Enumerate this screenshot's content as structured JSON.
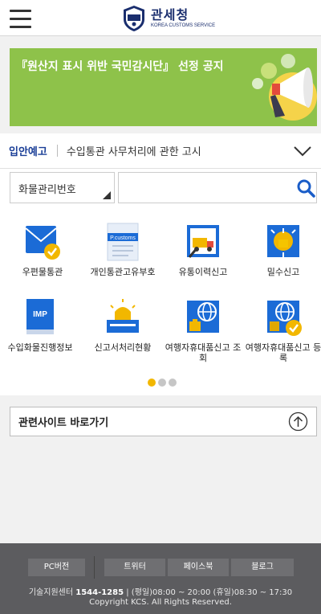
{
  "header": {
    "logo_ko": "관세청",
    "logo_en": "KOREA CUSTOMS SERVICE"
  },
  "banner": {
    "text": "『원산지 표시 위반 국민감시단』 선정 공지",
    "slide_count": 5,
    "active_slide": 1
  },
  "notice": {
    "label": "입안예고",
    "text": "수입통관 사무처리에 관한 고시"
  },
  "search": {
    "select_value": "화물관리번호",
    "input_value": "",
    "placeholder": ""
  },
  "menu": {
    "items": [
      {
        "label": "우편물통관",
        "icon": "mail-check-icon"
      },
      {
        "label": "개인통관고유부호",
        "icon": "pcustoms-doc-icon",
        "icon_text": "P.customs"
      },
      {
        "label": "유통이력신고",
        "icon": "truck-report-icon"
      },
      {
        "label": "밀수신고",
        "icon": "alarm-bell-icon"
      },
      {
        "label": "수입화물진행정보",
        "icon": "imp-book-icon",
        "icon_text": "IMP"
      },
      {
        "label": "신고서처리현황",
        "icon": "siren-report-icon"
      },
      {
        "label": "여행자휴대품신고 조회",
        "icon": "globe-bag-icon"
      },
      {
        "label": "여행자휴대품신고 등록",
        "icon": "globe-bag-check-icon"
      }
    ],
    "page_count": 3,
    "active_page": 1
  },
  "related": {
    "label": "관련사이트 바로가기"
  },
  "footer": {
    "links": [
      "PC버전",
      "트위터",
      "페이스북",
      "블로그"
    ],
    "support_label": "기술지원센터",
    "support_phone": "1544-1285",
    "hours": "| (평일)08:00 ~ 20:00 (휴일)08:30 ~ 17:30",
    "copyright": "Copyright KCS. All Rights Reserved."
  },
  "colors": {
    "brand_navy": "#1a2e6e",
    "banner_green": "#8ec24a",
    "accent_yellow": "#f2b700",
    "notice_blue": "#1a3e97",
    "footer_bg": "#5c5c5f"
  }
}
